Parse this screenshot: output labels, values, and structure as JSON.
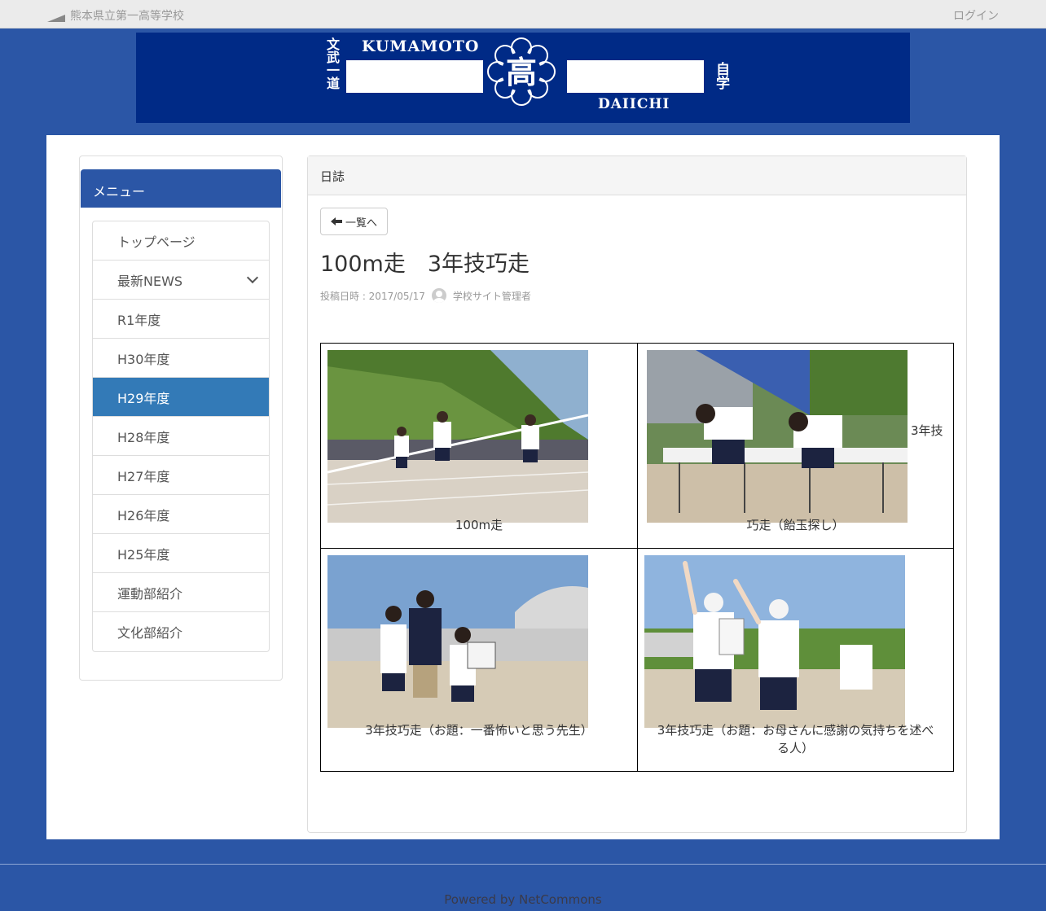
{
  "topbar": {
    "site_name": "熊本県立第一高等学校",
    "login_label": "ログイン"
  },
  "banner": {
    "motto_left": "文武一道",
    "motto_right": "自学",
    "word_top": "KUMAMOTO",
    "word_bottom": "DAIICHI",
    "emblem_char": "高"
  },
  "sidebar": {
    "title": "メニュー",
    "items": [
      {
        "label": "トップページ"
      },
      {
        "label": "最新NEWS"
      },
      {
        "label": "R1年度"
      },
      {
        "label": "H30年度"
      },
      {
        "label": "H29年度"
      },
      {
        "label": "H28年度"
      },
      {
        "label": "H27年度"
      },
      {
        "label": "H26年度"
      },
      {
        "label": "H25年度"
      },
      {
        "label": "運動部紹介"
      },
      {
        "label": "文化部紹介"
      }
    ]
  },
  "content": {
    "panel_title": "日誌",
    "back_label": "一覧へ",
    "post_title": "100m走　3年技巧走",
    "meta_label": "投稿日時 : 2017/05/17",
    "author": "学校サイト管理者"
  },
  "photos": {
    "cap1": "100m走",
    "cap2_side": "3年技",
    "cap2_bottom": "巧走（飴玉探し）",
    "cap3": "3年技巧走（お題：一番怖いと思う先生）",
    "cap4_line1": "3年技巧走（お題：お母さんに感謝の気持ちを述べ",
    "cap4_line2": "る人）"
  },
  "footer": {
    "powered": "Powered by NetCommons"
  }
}
